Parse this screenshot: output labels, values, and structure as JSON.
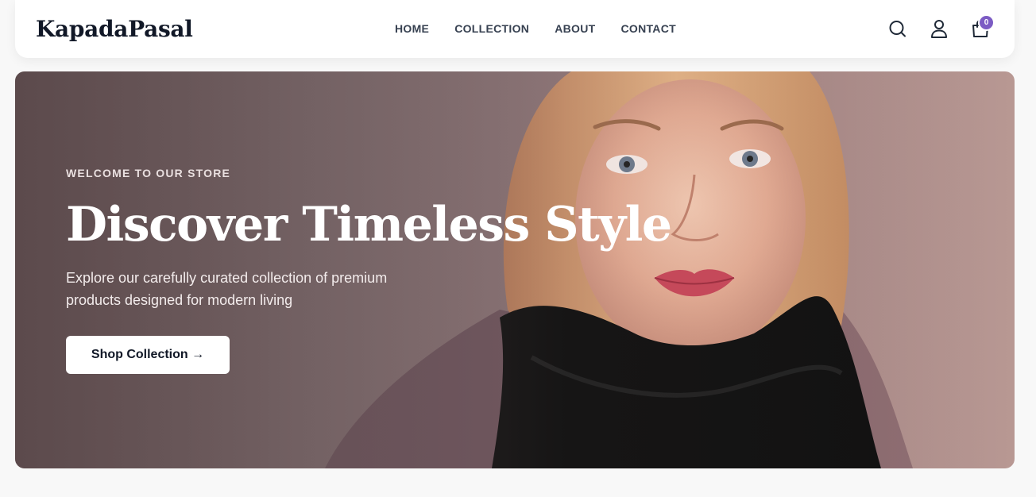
{
  "brand": {
    "name": "KapadaPasal"
  },
  "nav": {
    "links": [
      {
        "label": "HOME"
      },
      {
        "label": "COLLECTION"
      },
      {
        "label": "ABOUT"
      },
      {
        "label": "CONTACT"
      }
    ]
  },
  "header_icons": {
    "search": "search-icon",
    "account": "user-icon",
    "cart": "shopping-bag-icon",
    "cart_count": "0"
  },
  "hero": {
    "eyebrow": "WELCOME TO OUR STORE",
    "title": "Discover Timeless Style",
    "subtitle": "Explore our carefully curated collection of premium products designed for modern living",
    "cta_label": "Shop Collection →",
    "image": "portrait of a woman with blonde bob haircut wearing a black scarf"
  },
  "colors": {
    "accent_badge": "#7c5cc4",
    "text_dark": "#111827",
    "hero_bg": "#8d7577"
  }
}
